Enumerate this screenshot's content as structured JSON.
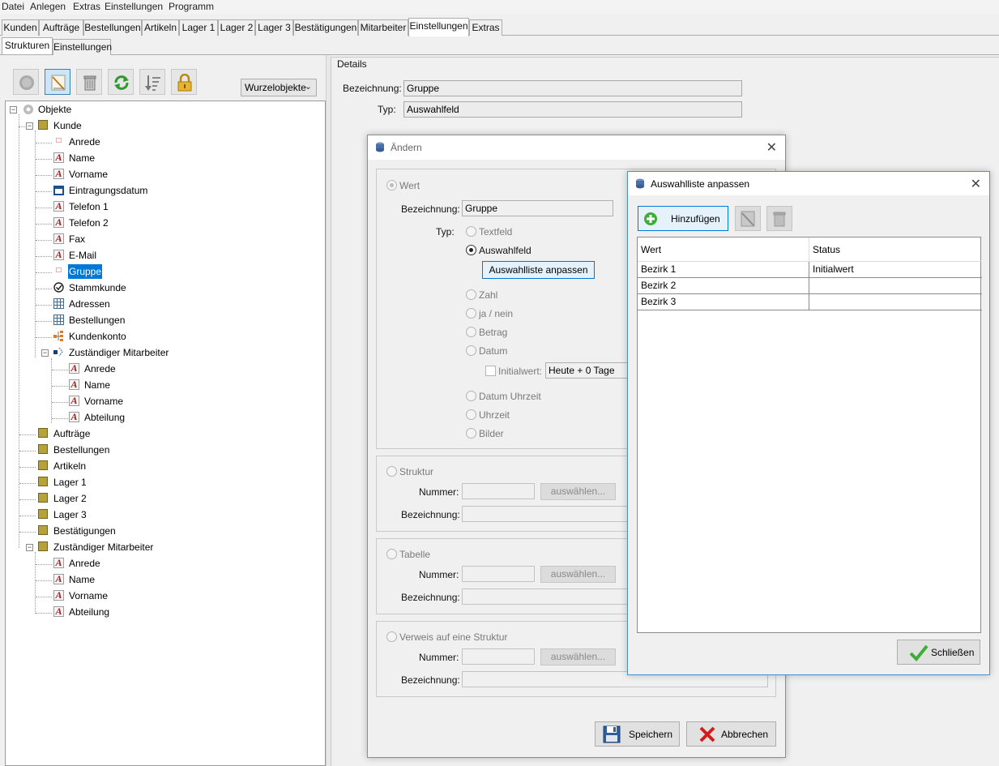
{
  "menu": [
    "Datei",
    "Anlegen",
    "Extras",
    "Einstellungen",
    "Programm"
  ],
  "main_tabs": [
    "Kunden",
    "Aufträge",
    "Bestellungen",
    "Artikeln",
    "Lager 1",
    "Lager 2",
    "Lager 3",
    "Bestätigungen",
    "Mitarbeiter",
    "Einstellungen",
    "Extras"
  ],
  "main_tab_active": "Einstellungen",
  "sub_tabs": [
    "Strukturen",
    "Einstellungen"
  ],
  "toolbar": {
    "icons": [
      "add-disabled-icon",
      "edit-icon",
      "delete-icon",
      "refresh-icon",
      "sort-icon",
      "lock-icon"
    ],
    "root_select": "Wurzelobjekte"
  },
  "tree": {
    "root": "Objekte",
    "kunde": "Kunde",
    "kunde_children": [
      "Anrede",
      "Name",
      "Vorname",
      "Eintragungsdatum",
      "Telefon 1",
      "Telefon 2",
      "Fax",
      "E-Mail",
      "Gruppe",
      "Stammkunde",
      "Adressen",
      "Bestellungen",
      "Kundenkonto"
    ],
    "kunde_mitarbeiter": "Zuständiger Mitarbeiter",
    "kunde_mitarbeiter_children": [
      "Anrede",
      "Name",
      "Vorname",
      "Abteilung"
    ],
    "top_structures": [
      "Aufträge",
      "Bestellungen",
      "Artikeln",
      "Lager 1",
      "Lager 2",
      "Lager 3",
      "Bestätigungen"
    ],
    "mitarbeiter": "Zuständiger Mitarbeiter",
    "mitarbeiter_children": [
      "Anrede",
      "Name",
      "Vorname",
      "Abteilung"
    ],
    "selected": "Gruppe"
  },
  "details": {
    "title": "Details",
    "bezeichnung_label": "Bezeichnung:",
    "bezeichnung_value": "Gruppe",
    "typ_label": "Typ:",
    "typ_value": "Auswahlfeld"
  },
  "aendern": {
    "title": "Ändern",
    "wert": "Wert",
    "bezeichnung_label": "Bezeichnung:",
    "bezeichnung_value": "Gruppe",
    "typ_label": "Typ:",
    "types": [
      "Textfeld",
      "Auswahlfeld",
      "Zahl",
      "ja / nein",
      "Betrag",
      "Datum",
      "Datum Uhrzeit",
      "Uhrzeit",
      "Bilder"
    ],
    "selected_type": "Auswahlfeld",
    "auswahlliste_button": "Auswahlliste anpassen",
    "initialwert_label": "Initialwert:",
    "initialwert_value": "Heute + 0 Tage",
    "struktur": "Struktur",
    "tabelle": "Tabelle",
    "verweis": "Verweis auf eine Struktur",
    "nummer_label": "Nummer:",
    "auswaehlen": "auswählen...",
    "save": "Speichern",
    "cancel": "Abbrechen"
  },
  "auswahlliste": {
    "title": "Auswahlliste anpassen",
    "add": "Hinzufügen",
    "columns": [
      "Wert",
      "Status"
    ],
    "rows": [
      {
        "wert": "Bezirk 1",
        "status": "Initialwert"
      },
      {
        "wert": "Bezirk 2",
        "status": ""
      },
      {
        "wert": "Bezirk 3",
        "status": ""
      }
    ],
    "close": "Schließen"
  },
  "colors": {
    "selection": "#0078d7",
    "dialog_border": "#4a90d0",
    "add_green": "#3cae38",
    "cancel_red": "#d21d1d"
  }
}
